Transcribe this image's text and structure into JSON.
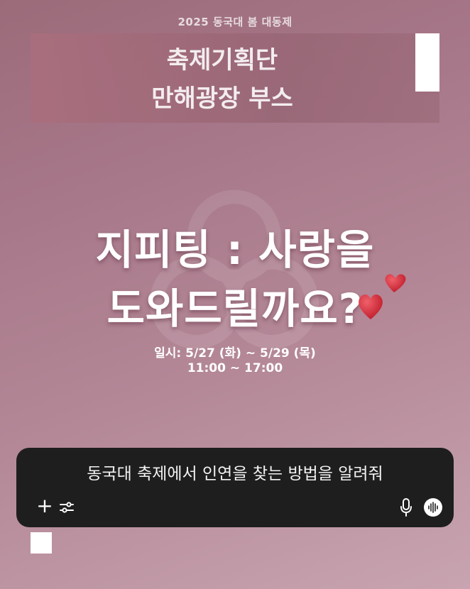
{
  "top_caption": "2025 동국대 봄 대동제",
  "banner": {
    "line1": "축제기획단",
    "line2": "만해광장 부스"
  },
  "headline": {
    "line1": "지피팅 : 사랑을",
    "line2": "도와드릴까요?"
  },
  "schedule": {
    "dates": "일시: 5/27 (화) ~ 5/29 (목)",
    "hours": "11:00 ~ 17:00"
  },
  "chat": {
    "prompt": "동국대 축제에서 인연을 찾는 방법을 알려줘",
    "icons": [
      "plus-icon",
      "tune-icon",
      "microphone-icon",
      "voice-mode-icon"
    ]
  },
  "colors": {
    "background": "#a7788a",
    "chat_box": "#1e1e1e",
    "heart": "#d8323f"
  }
}
